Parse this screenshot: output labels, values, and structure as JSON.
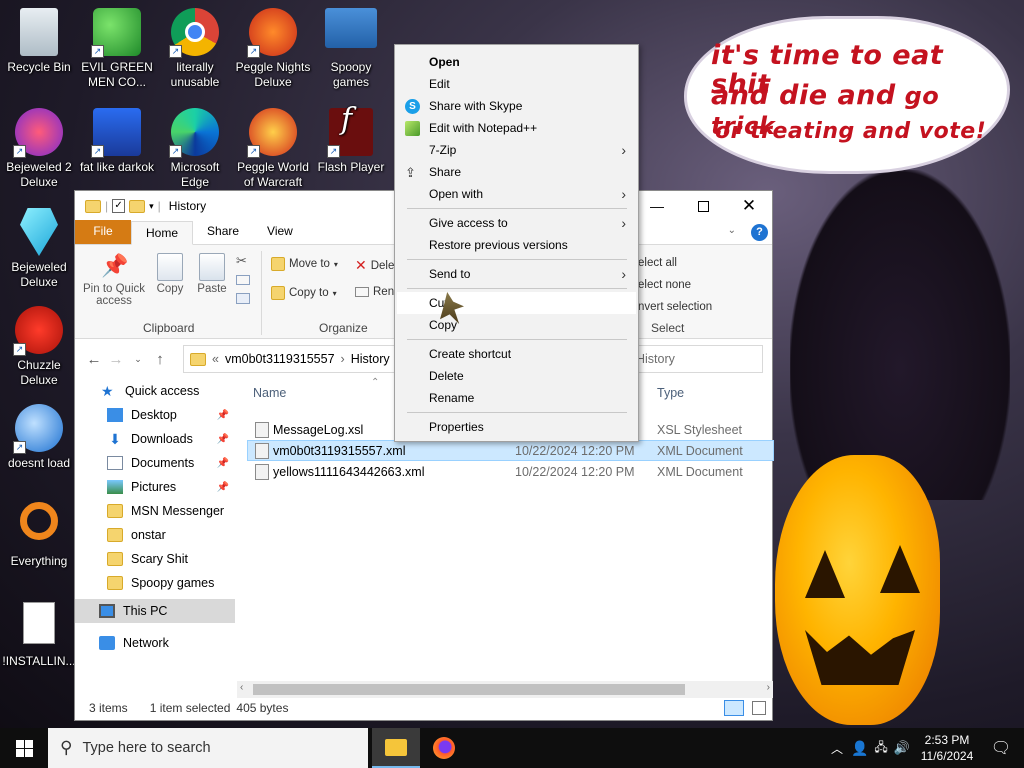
{
  "desktop": {
    "icons": [
      {
        "label": "Recycle Bin",
        "icon": "recycle-bin-icon"
      },
      {
        "label": "EVIL GREEN MEN CO...",
        "icon": "msn-messenger-icon"
      },
      {
        "label": "literally unusable",
        "icon": "chrome-icon"
      },
      {
        "label": "Peggle Nights Deluxe",
        "icon": "peggle-nights-icon"
      },
      {
        "label": "Spoopy games",
        "icon": "computer-network-icon"
      },
      {
        "label": "Bejeweled 2 Deluxe",
        "icon": "bejeweled-2-icon"
      },
      {
        "label": "fat like darkok",
        "icon": "mpl-icon"
      },
      {
        "label": "Microsoft Edge",
        "icon": "edge-icon"
      },
      {
        "label": "Peggle World of Warcraft",
        "icon": "peggle-world-icon"
      },
      {
        "label": "Flash Player",
        "icon": "flash-player-icon"
      },
      {
        "label": "Bejeweled Deluxe",
        "icon": "bejeweled-icon"
      },
      {
        "label": "Chuzzle Deluxe",
        "icon": "chuzzle-icon"
      },
      {
        "label": "doesnt load",
        "icon": "thunderbird-icon"
      },
      {
        "label": "Everything",
        "icon": "everything-search-icon"
      },
      {
        "label": "!INSTALLIN...",
        "icon": "text-document-icon"
      }
    ],
    "bubble_line1": "it's time to eat shit",
    "bubble_line2a": "and die and",
    "bubble_line2b": " go trick",
    "bubble_line3": "or treating and vote!"
  },
  "explorer": {
    "title": "History",
    "tabs": {
      "file": "File",
      "home": "Home",
      "share": "Share",
      "view": "View"
    },
    "ribbon": {
      "pin": "Pin to Quick access",
      "copy": "Copy",
      "paste": "Paste",
      "clipboard": "Clipboard",
      "move_to": "Move to",
      "copy_to": "Copy to",
      "delete": "Dele",
      "rename": "Ren",
      "organize": "Organize",
      "select_all": "elect all",
      "select_none": "elect none",
      "invert": "nvert selection",
      "select": "Select"
    },
    "address": {
      "chevron": "«",
      "folder": "vm0b0t3119315557",
      "sep": "›",
      "current": "History"
    },
    "search_placeholder": "History",
    "nav": [
      {
        "label": "Quick access",
        "pinned": false
      },
      {
        "label": "Desktop",
        "pinned": true
      },
      {
        "label": "Downloads",
        "pinned": true
      },
      {
        "label": "Documents",
        "pinned": true
      },
      {
        "label": "Pictures",
        "pinned": true
      },
      {
        "label": "MSN Messenger",
        "pinned": false
      },
      {
        "label": "onstar",
        "pinned": false
      },
      {
        "label": "Scary Shit",
        "pinned": false
      },
      {
        "label": "Spoopy games",
        "pinned": false
      },
      {
        "label": "This PC",
        "pinned": false
      },
      {
        "label": "Network",
        "pinned": false
      }
    ],
    "columns": {
      "name": "Name",
      "type": "Type"
    },
    "files": [
      {
        "name": "MessageLog.xsl",
        "date": "",
        "type": "XSL Stylesheet",
        "selected": false
      },
      {
        "name": "vm0b0t3119315557.xml",
        "date": "10/22/2024 12:20 PM",
        "type": "XML Document",
        "selected": true
      },
      {
        "name": "yellows1111643442663.xml",
        "date": "10/22/2024 12:20 PM",
        "type": "XML Document",
        "selected": false
      }
    ],
    "status": {
      "items": "3 items",
      "selected": "1 item selected",
      "size": "405 bytes"
    }
  },
  "context_menu": {
    "items": [
      {
        "label": "Open",
        "bold": true,
        "icon": "",
        "submenu": false
      },
      {
        "label": "Edit",
        "bold": false,
        "icon": "",
        "submenu": false
      },
      {
        "label": "Share with Skype",
        "bold": false,
        "icon": "skype-icon",
        "submenu": false
      },
      {
        "label": "Edit with Notepad++",
        "bold": false,
        "icon": "notepad-plus-plus-icon",
        "submenu": false
      },
      {
        "label": "7-Zip",
        "bold": false,
        "icon": "",
        "submenu": true
      },
      {
        "label": "Share",
        "bold": false,
        "icon": "share-icon",
        "submenu": false
      },
      {
        "label": "Open with",
        "bold": false,
        "icon": "",
        "submenu": true
      },
      {
        "label": "Give access to",
        "bold": false,
        "icon": "",
        "submenu": true
      },
      {
        "label": "Restore previous versions",
        "bold": false,
        "icon": "",
        "submenu": false
      },
      {
        "label": "Send to",
        "bold": false,
        "icon": "",
        "submenu": true
      },
      {
        "label": "Cut",
        "bold": false,
        "icon": "",
        "submenu": false
      },
      {
        "label": "Copy",
        "bold": false,
        "icon": "",
        "submenu": false
      },
      {
        "label": "Create shortcut",
        "bold": false,
        "icon": "",
        "submenu": false
      },
      {
        "label": "Delete",
        "bold": false,
        "icon": "",
        "submenu": false
      },
      {
        "label": "Rename",
        "bold": false,
        "icon": "",
        "submenu": false
      },
      {
        "label": "Properties",
        "bold": false,
        "icon": "",
        "submenu": false
      }
    ]
  },
  "taskbar": {
    "search_placeholder": "Type here to search",
    "time": "2:53 PM",
    "date": "11/6/2024"
  },
  "colors": {
    "ribbon_file": "#d57b14",
    "selection": "#cce8ff",
    "caption_red": "#c4121f",
    "taskbar": "#0e0e0e"
  }
}
